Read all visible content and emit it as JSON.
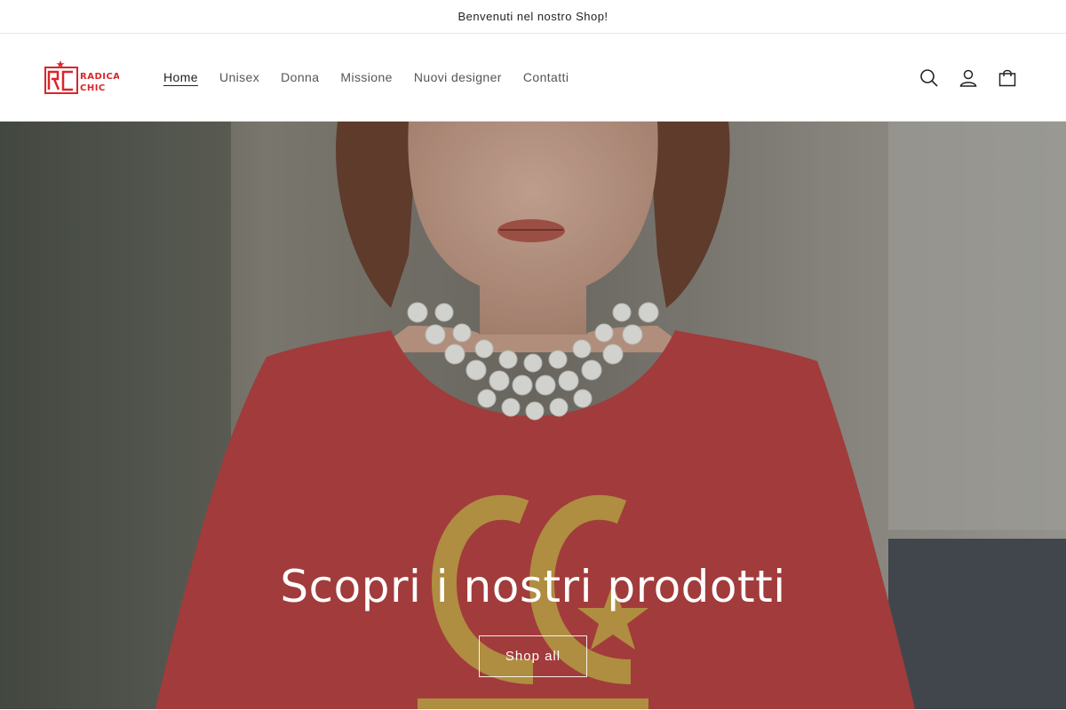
{
  "announcement": {
    "text": "Benvenuti nel nostro Shop!"
  },
  "header": {
    "logo": {
      "brand_color": "#d8262c",
      "icon": "radical-chic-logo"
    },
    "nav": [
      {
        "label": "Home",
        "active": true
      },
      {
        "label": "Unisex",
        "active": false
      },
      {
        "label": "Donna",
        "active": false
      },
      {
        "label": "Missione",
        "active": false
      },
      {
        "label": "Nuovi designer",
        "active": false
      },
      {
        "label": "Contatti",
        "active": false
      }
    ],
    "icons": [
      "search-icon",
      "account-icon",
      "cart-icon"
    ]
  },
  "hero": {
    "title": "Scopri i nostri prodotti",
    "button_label": "Shop all",
    "tshirt_color": "#b94444",
    "print_color": "#c8a14a"
  }
}
